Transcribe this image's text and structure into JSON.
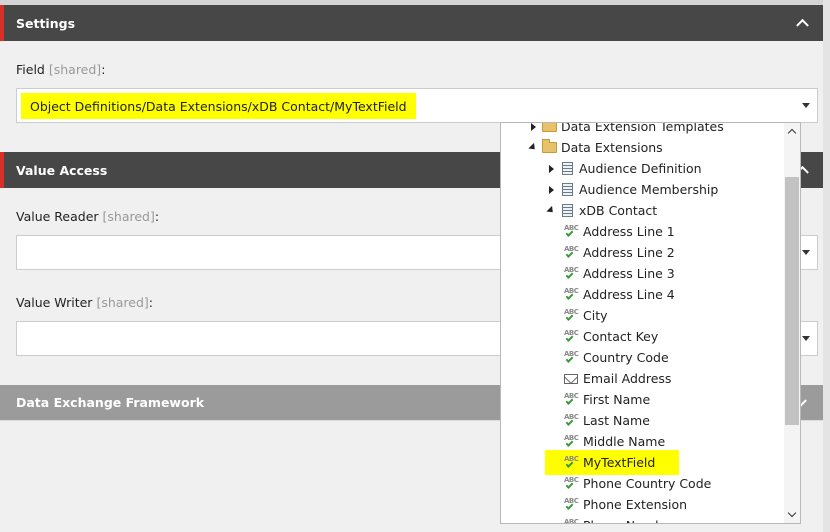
{
  "settings": {
    "title": "Settings",
    "field_label": "Field",
    "field_shared": "[shared]",
    "field_colon": ":",
    "field_value": "Object Definitions/Data Extensions/xDB Contact/MyTextField"
  },
  "value_access": {
    "title": "Value Access",
    "reader_label": "Value Reader",
    "reader_shared": "[shared]",
    "reader_colon": ":",
    "writer_label": "Value Writer",
    "writer_shared": "[shared]",
    "writer_colon": ":"
  },
  "data_exchange": {
    "title": "Data Exchange Framework"
  },
  "tree": {
    "items": [
      {
        "label": "Data Extension Templates",
        "icon": "folder-icon",
        "expander": "collapsed"
      },
      {
        "label": "Data Extensions",
        "icon": "folder-icon",
        "expander": "expanded"
      },
      {
        "label": "Audience Definition",
        "icon": "template-icon",
        "expander": "collapsed"
      },
      {
        "label": "Audience Membership",
        "icon": "template-icon",
        "expander": "collapsed"
      },
      {
        "label": "xDB Contact",
        "icon": "template-icon",
        "expander": "expanded"
      },
      {
        "label": "Address Line 1",
        "icon": "text-field-icon"
      },
      {
        "label": "Address Line 2",
        "icon": "text-field-icon"
      },
      {
        "label": "Address Line 3",
        "icon": "text-field-icon"
      },
      {
        "label": "Address Line 4",
        "icon": "text-field-icon"
      },
      {
        "label": "City",
        "icon": "text-field-icon"
      },
      {
        "label": "Contact Key",
        "icon": "text-field-icon"
      },
      {
        "label": "Country Code",
        "icon": "text-field-icon"
      },
      {
        "label": "Email Address",
        "icon": "email-icon"
      },
      {
        "label": "First Name",
        "icon": "text-field-icon"
      },
      {
        "label": "Last Name",
        "icon": "text-field-icon"
      },
      {
        "label": "Middle Name",
        "icon": "text-field-icon"
      },
      {
        "label": "MyTextField",
        "icon": "text-field-icon",
        "selected": true
      },
      {
        "label": "Phone Country Code",
        "icon": "text-field-icon"
      },
      {
        "label": "Phone Extension",
        "icon": "text-field-icon"
      },
      {
        "label": "Phone Number",
        "icon": "text-field-icon"
      }
    ]
  },
  "colors": {
    "highlight": "#ffff00",
    "header_dark": "#474747",
    "header_accent": "#d9302a",
    "header_grey": "#9b9b9b"
  }
}
